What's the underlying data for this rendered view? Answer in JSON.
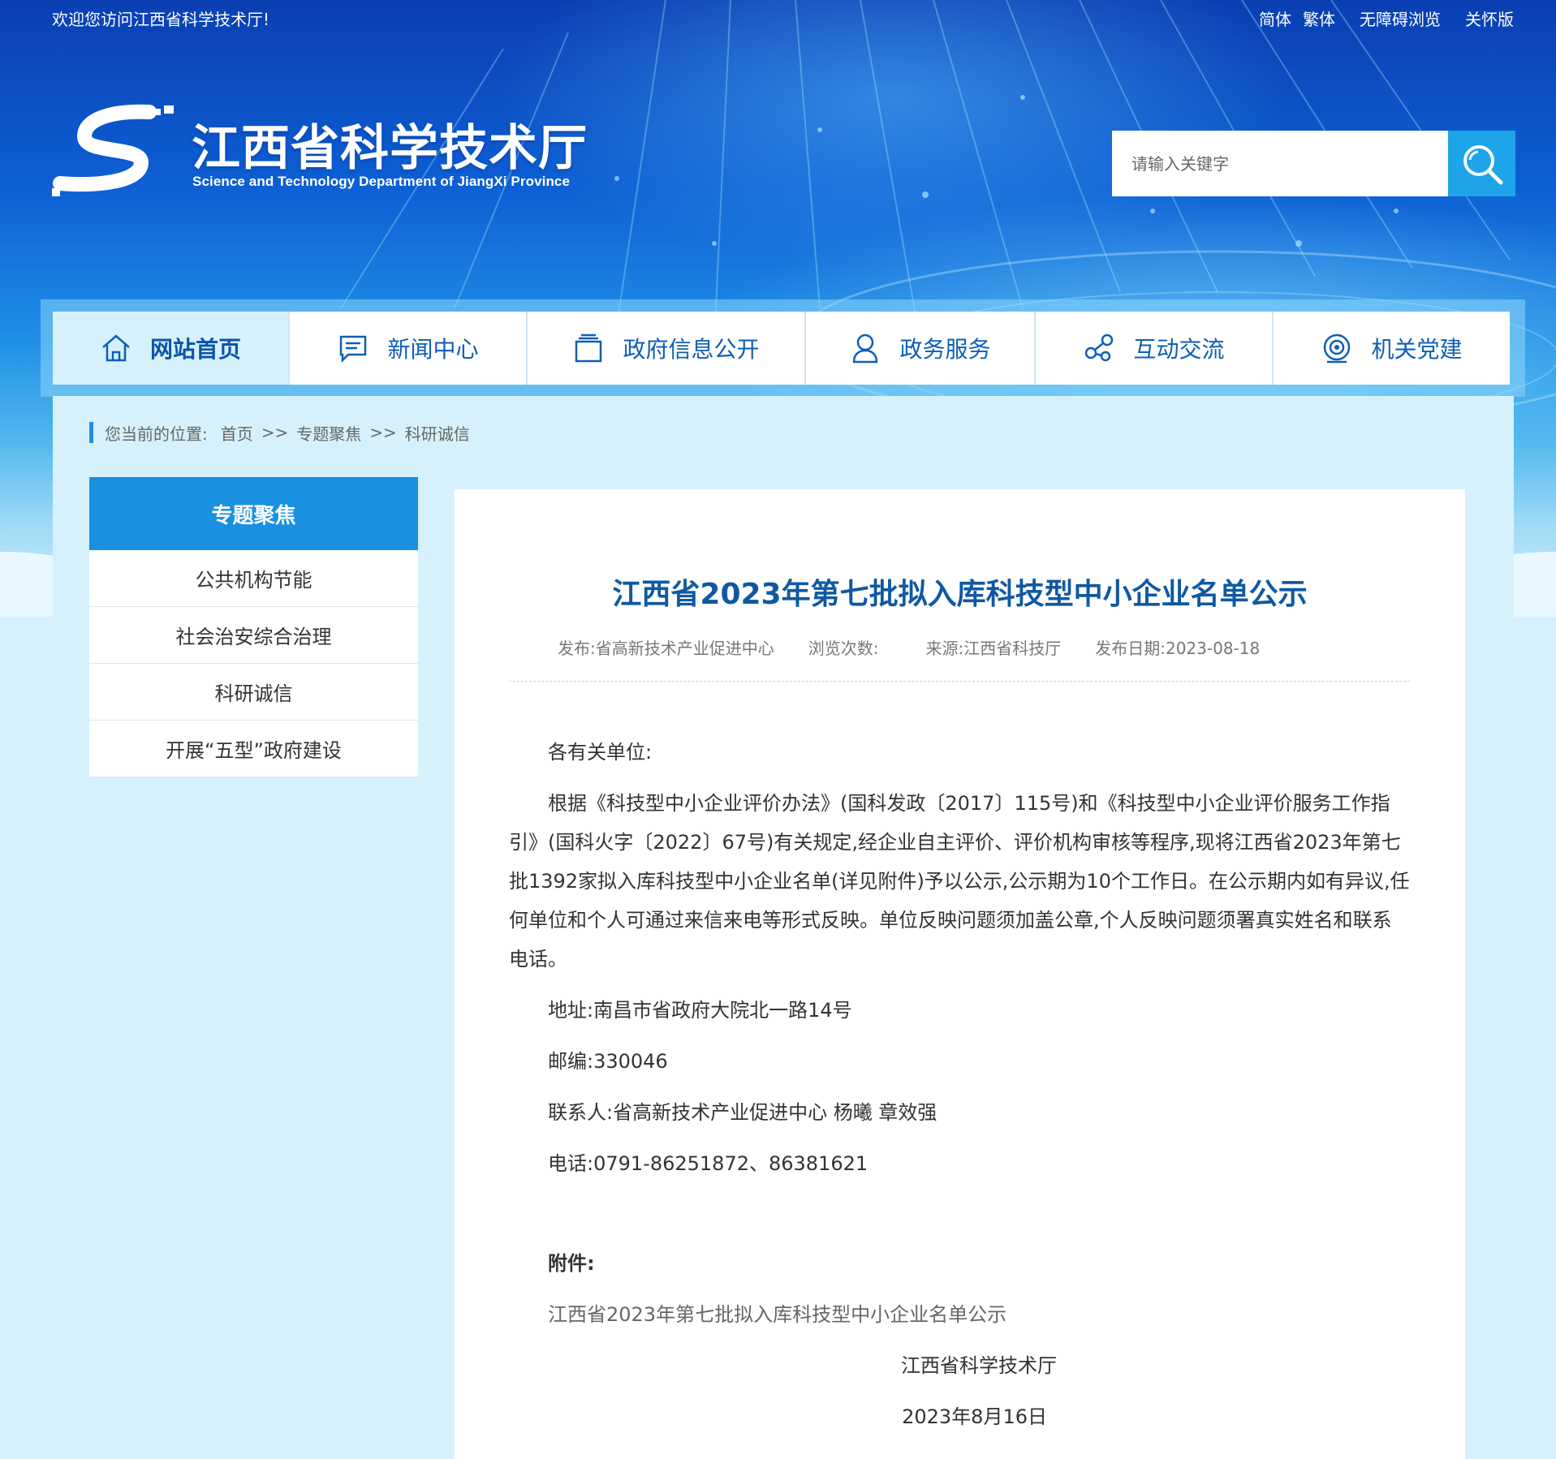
{
  "topbar": {
    "welcome": "欢迎您访问江西省科学技术厅!",
    "links": [
      "简体",
      "繁体",
      "无障碍浏览",
      "关怀版"
    ]
  },
  "logo": {
    "title": "江西省科学技术厅",
    "subtitle": "Science and Technology Department of JiangXi Province"
  },
  "search": {
    "placeholder": "请输入关键字",
    "icon": "search-icon"
  },
  "nav": [
    {
      "label": "网站首页",
      "icon": "home-icon",
      "active": true
    },
    {
      "label": "新闻中心",
      "icon": "news-icon"
    },
    {
      "label": "政府信息公开",
      "icon": "folder-icon"
    },
    {
      "label": "政务服务",
      "icon": "user-icon"
    },
    {
      "label": "互动交流",
      "icon": "interaction-icon"
    },
    {
      "label": "机关党建",
      "icon": "party-icon"
    }
  ],
  "breadcrumb": {
    "prefix": "您当前的位置:",
    "items": [
      "首页",
      "专题聚焦",
      "科研诚信"
    ],
    "separator": ">>"
  },
  "sidebar": {
    "heading": "专题聚焦",
    "items": [
      "公共机构节能",
      "社会治安综合治理",
      "科研诚信",
      "开展“五型”政府建设"
    ]
  },
  "article": {
    "title": "江西省2023年第七批拟入库科技型中小企业名单公示",
    "meta": {
      "publisher": "发布:省高新技术产业促进中心",
      "views": "浏览次数:",
      "source": "来源:江西省科技厅",
      "date": "发布日期:2023-08-18"
    },
    "greeting": "各有关单位:",
    "body": "根据《科技型中小企业评价办法》(国科发政〔2017〕115号)和《科技型中小企业评价服务工作指引》(国科火字〔2022〕67号)有关规定,经企业自主评价、评价机构审核等程序,现将江西省2023年第七批1392家拟入库科技型中小企业名单(详见附件)予以公示,公示期为10个工作日。在公示期内如有异议,任何单位和个人可通过来信来电等形式反映。单位反映问题须加盖公章,个人反映问题须署真实姓名和联系电话。",
    "address": "地址:南昌市省政府大院北一路14号",
    "postcode": "邮编:330046",
    "contact": "联系人:省高新技术产业促进中心 杨曦 章效强",
    "phone": "电话:0791-86251872、86381621",
    "attachment_heading": "附件:",
    "attachment_link": "江西省2023年第七批拟入库科技型中小企业名单公示",
    "signature": "江西省科学技术厅",
    "sign_date": "2023年8月16日"
  },
  "colors": {
    "brand_blue": "#0f59a2",
    "nav_text": "#0d5fb5",
    "side_head": "#1990e0",
    "search_button": "#1ea4e8",
    "page_bg": "#d6f1fb"
  }
}
